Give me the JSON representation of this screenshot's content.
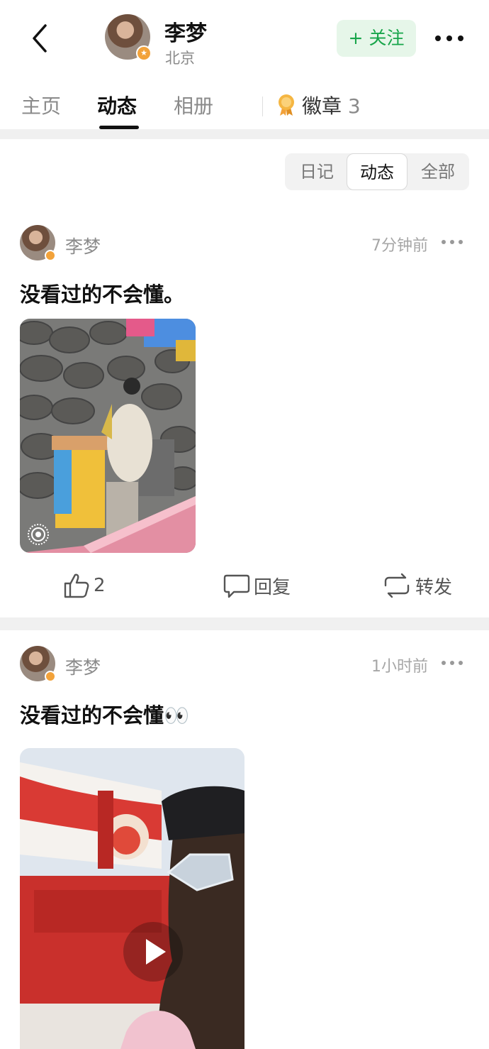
{
  "header": {
    "name": "李梦",
    "location": "北京",
    "follow_label": "+ 关注"
  },
  "tabs": [
    {
      "label": "主页"
    },
    {
      "label": "动态"
    },
    {
      "label": "相册"
    }
  ],
  "badges": {
    "label": "徽章",
    "count": "3"
  },
  "filter": [
    "日记",
    "动态",
    "全部"
  ],
  "posts": [
    {
      "author": "李梦",
      "time": "7分钟前",
      "text": "没看过的不会懂。",
      "likes": "2",
      "reply_label": "回复",
      "repost_label": "转发"
    },
    {
      "author": "李梦",
      "time": "1小时前",
      "text": "没看过的不会懂👀"
    }
  ],
  "colors": {
    "accent_green": "#17a54a",
    "follow_bg": "#e6f6e9",
    "badge_gold": "#f2a23a"
  }
}
